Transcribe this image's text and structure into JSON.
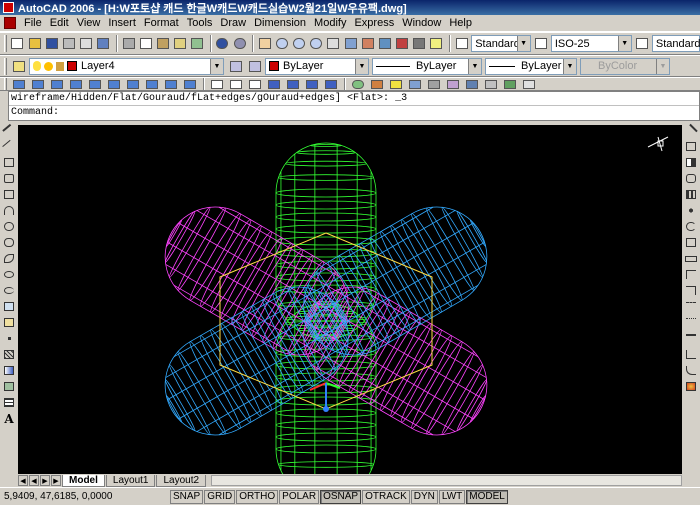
{
  "window": {
    "title": "AutoCAD 2006 - [H:W포토샵 캐드 한글W캐드W캐드실습W2월21일W우유팩.dwg]"
  },
  "menu": [
    "File",
    "Edit",
    "View",
    "Insert",
    "Format",
    "Tools",
    "Draw",
    "Dimension",
    "Modify",
    "Express",
    "Window",
    "Help"
  ],
  "styles": {
    "text_style": "Standard",
    "dim_style": "ISO-25",
    "table_style": "Standard"
  },
  "layers": {
    "current_layer": "Layer4",
    "color": "ByLayer",
    "color_hex": "#cc0000",
    "linetype": "ByLayer",
    "lineweight": "ByLayer",
    "plot_style": "ByColor"
  },
  "command": {
    "history": "wireframe/Hidden/Flat/Gouraud/fLat+edges/gOuraud+edges] <Flat>: _3",
    "prompt": "Command:"
  },
  "tabs": [
    "Model",
    "Layout1",
    "Layout2"
  ],
  "active_tab": "Model",
  "status": {
    "coordinates": "5,9409, 47,6185, 0,0000",
    "toggles": [
      "SNAP",
      "GRID",
      "ORTHO",
      "POLAR",
      "OSNAP",
      "OTRACK",
      "DYN",
      "LWT",
      "MODEL"
    ],
    "toggles_on": [
      "OSNAP",
      "MODEL"
    ]
  },
  "colors": {
    "canvas": "#000000",
    "green": "#33ff33",
    "magenta": "#ff44ff",
    "cyan": "#33aaff",
    "yellow": "#ffdd44"
  }
}
